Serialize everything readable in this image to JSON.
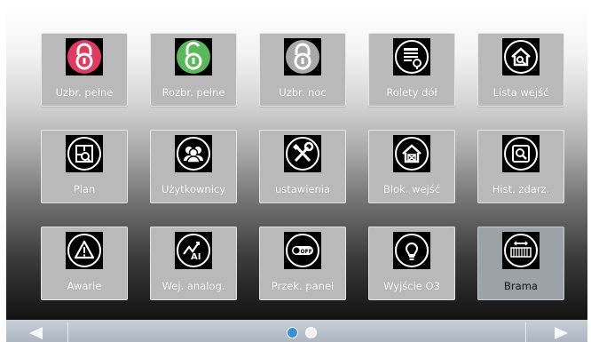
{
  "tiles": [
    {
      "label": "Uzbr. pełne",
      "icon": "padlock-closed-red-icon",
      "color": "#e03a61"
    },
    {
      "label": "Rozbr. pełne",
      "icon": "padlock-open-green-icon",
      "color": "#5bb85a"
    },
    {
      "label": "Uzbr. noc",
      "icon": "padlock-grey-icon",
      "color": "#a8a8a8"
    },
    {
      "label": "Rolety dół",
      "icon": "blinds-down-icon"
    },
    {
      "label": "Lista wejść",
      "icon": "house-list-icon"
    },
    {
      "label": "Plan",
      "icon": "floor-plan-icon"
    },
    {
      "label": "Użytkownicy",
      "icon": "users-icon"
    },
    {
      "label": "ustawienia",
      "icon": "tools-icon"
    },
    {
      "label": "Blok. wejść",
      "icon": "house-block-icon"
    },
    {
      "label": "Hist. zdarz.",
      "icon": "history-icon"
    },
    {
      "label": "Awarie",
      "icon": "warning-icon"
    },
    {
      "label": "Wej. analog.",
      "icon": "analog-input-icon"
    },
    {
      "label": "Przek. panel",
      "icon": "off-switch-icon",
      "badge": "OFF"
    },
    {
      "label": "Wyjście O3",
      "icon": "lightbulb-icon"
    },
    {
      "label": "Brama",
      "icon": "gate-icon",
      "selected": true
    }
  ],
  "nav": {
    "prev": "arrow-left-icon",
    "next": "arrow-right-icon",
    "pages": 2,
    "current_page": 1
  }
}
